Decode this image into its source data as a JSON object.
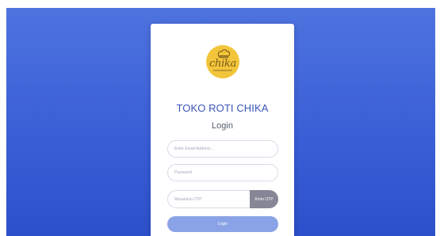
{
  "brand": {
    "logo_text": "chika",
    "store_name": "TOKO ROTI CHIKA"
  },
  "login": {
    "title": "Login",
    "email_placeholder": "Enter Email Address...",
    "password_placeholder": "Password",
    "otp_placeholder": "Masukkan OTP",
    "otp_button_label": "Kirim OTP",
    "login_button_label": "Login"
  },
  "colors": {
    "background": "#4e73df",
    "card": "#ffffff",
    "logo_circle": "#f2c53a",
    "store_name": "#3a55b8",
    "otp_button": "#858796",
    "login_button": "#8aa3e6"
  },
  "icons": {
    "logo_mark": "chef-hat-icon"
  }
}
